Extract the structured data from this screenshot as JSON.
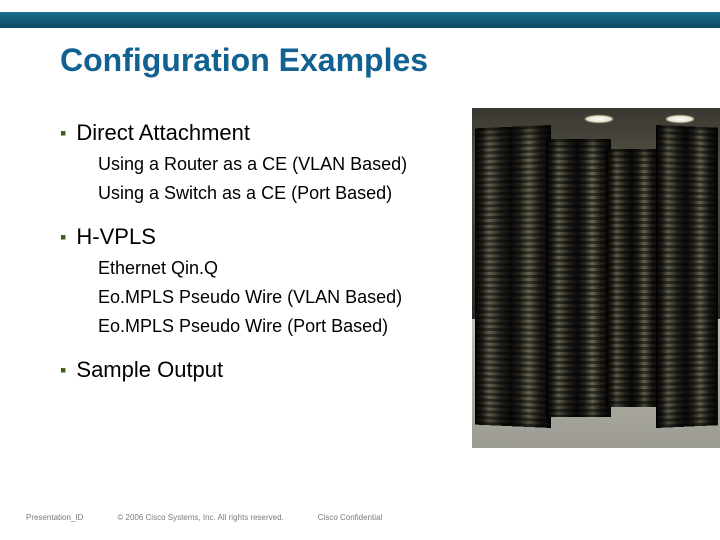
{
  "title": "Configuration Examples",
  "sections": {
    "s0": {
      "head": "Direct Attachment",
      "sub": [
        "Using a Router as a CE (VLAN Based)",
        "Using a Switch as a CE (Port Based)"
      ]
    },
    "s1": {
      "head": "H-VPLS",
      "sub": [
        "Ethernet Qin.Q",
        "Eo.MPLS Pseudo Wire (VLAN Based)",
        "Eo.MPLS Pseudo Wire (Port Based)"
      ]
    },
    "s2": {
      "head": "Sample Output",
      "sub": []
    }
  },
  "footer": {
    "presentation_id": "Presentation_ID",
    "copyright": "© 2006 Cisco Systems, Inc. All rights reserved.",
    "confidential": "Cisco Confidential"
  },
  "image_alt": "Photograph of data center server racks"
}
